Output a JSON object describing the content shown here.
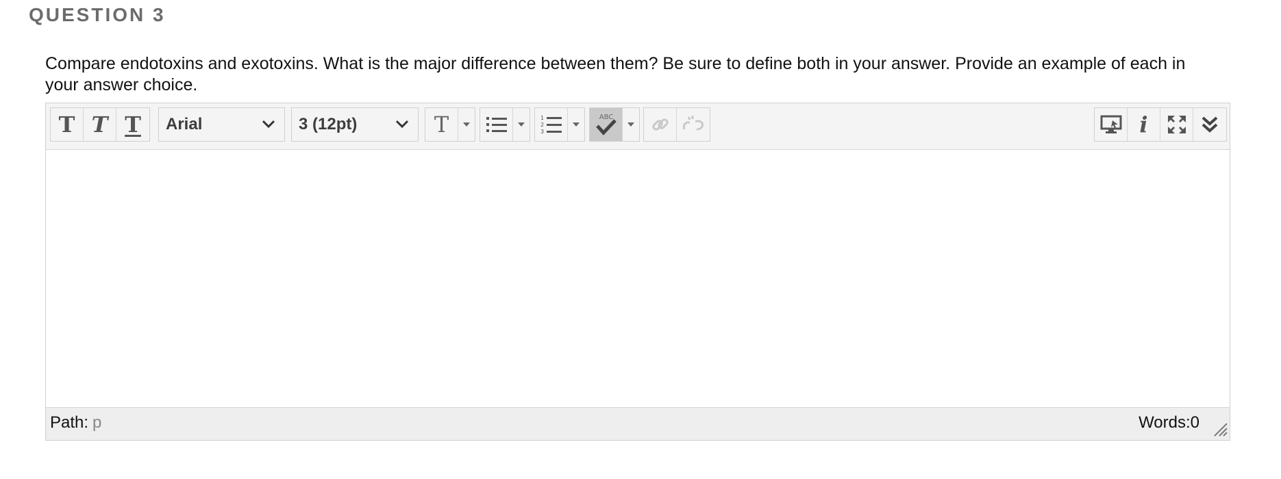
{
  "question": {
    "header": "QUESTION 3",
    "prompt": "Compare endotoxins and exotoxins. What is the major difference between them? Be sure to define both in your answer. Provide an example of each in your answer choice."
  },
  "toolbar": {
    "format_buttons": [
      {
        "name": "bold-button",
        "glyph": "T",
        "icon": "bold-icon"
      },
      {
        "name": "italic-button",
        "glyph": "T",
        "icon": "italic-icon"
      },
      {
        "name": "underline-button",
        "glyph": "T",
        "icon": "underline-icon"
      }
    ],
    "font_family": {
      "selected": "Arial"
    },
    "font_size": {
      "selected": "3 (12pt)"
    },
    "text_color_glyph": "T",
    "icons": {
      "text_color": "text-color-icon",
      "bullet_list": "bullet-list-icon",
      "numbered_list": "numbered-list-icon",
      "spellcheck": "spellcheck-icon",
      "insert_link": "link-icon",
      "unlink": "unlink-icon",
      "preview": "preview-icon",
      "info": "info-icon",
      "fullscreen": "fullscreen-icon",
      "expand_toolbar": "double-chevron-down-icon"
    },
    "spellcheck_label": "ABC",
    "info_glyph": "i"
  },
  "editor": {
    "content": ""
  },
  "status": {
    "path_label": "Path:",
    "path_value": "p",
    "words_label": "Words:0"
  },
  "colors": {
    "header_gray": "#6b6b6b",
    "toolbar_bg": "#f4f4f4",
    "status_bg": "#eeeeee",
    "border": "#cfcfcf",
    "icon_gray": "#555555"
  }
}
